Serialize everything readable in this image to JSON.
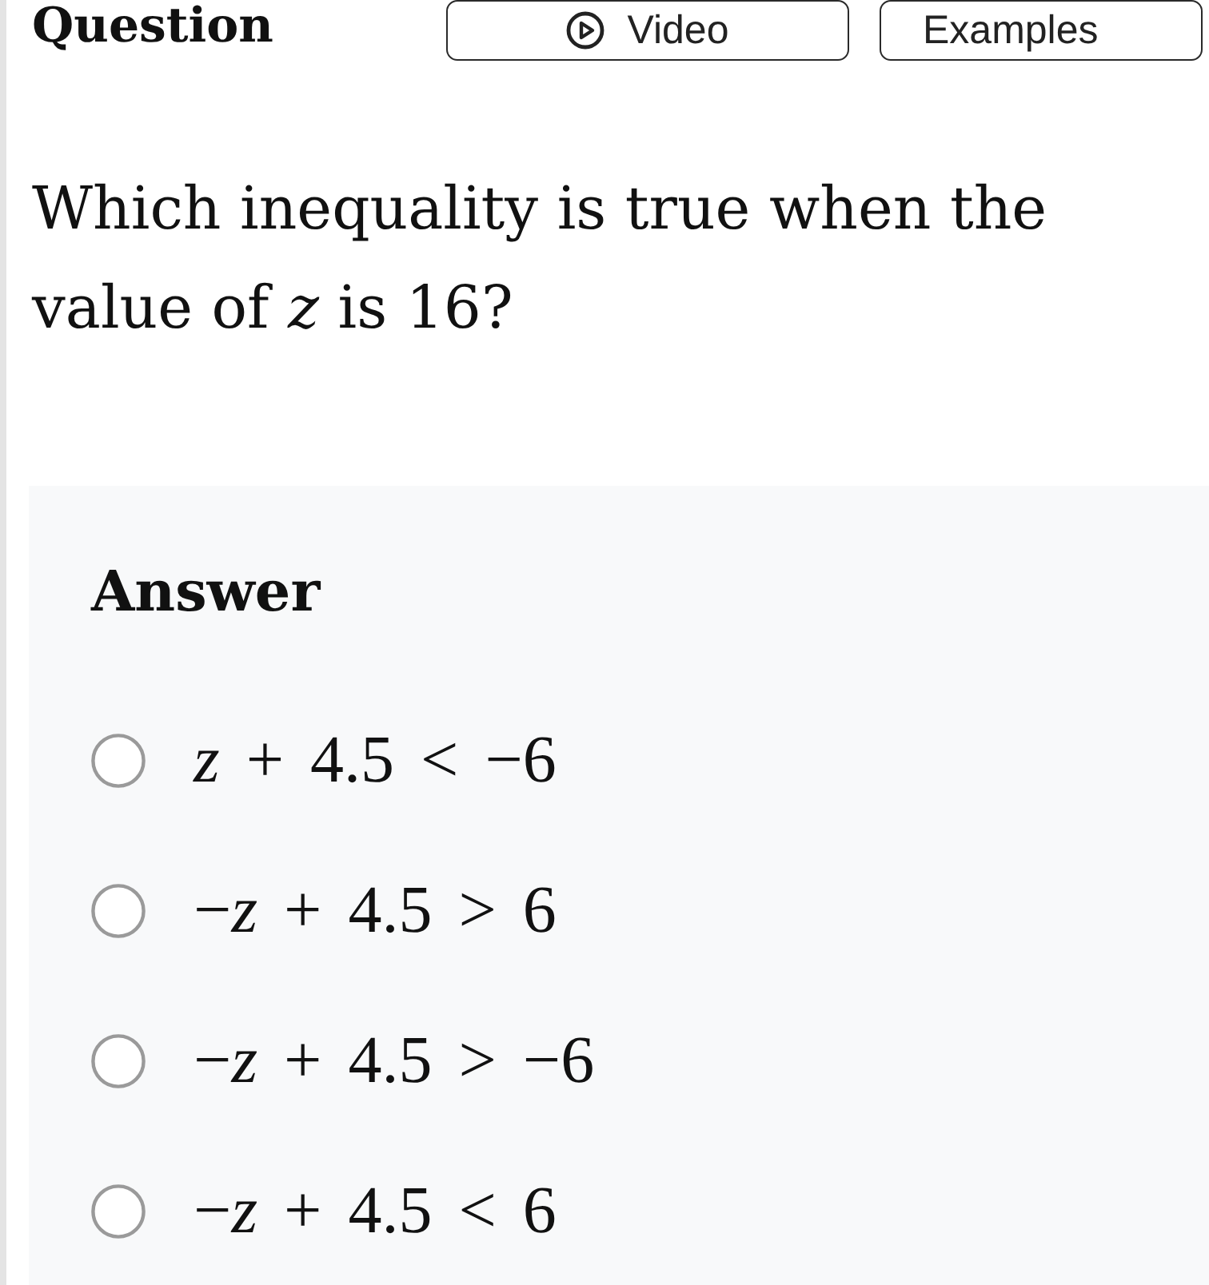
{
  "header": {
    "title": "Question",
    "buttons": [
      {
        "label": "Video",
        "kind": "video"
      },
      {
        "label": "Examples",
        "kind": "plain"
      }
    ]
  },
  "question": "Which inequality is true when the value of *z* is 16?",
  "answer": {
    "title": "Answer",
    "options": [
      {
        "text": "*z* + 4.5 < −6",
        "selected": false
      },
      {
        "text": "−*z* + 4.5 > 6",
        "selected": false
      },
      {
        "text": "−*z* + 4.5 > −6",
        "selected": false
      },
      {
        "text": "−*z* + 4.5 < 6",
        "selected": false
      }
    ]
  }
}
